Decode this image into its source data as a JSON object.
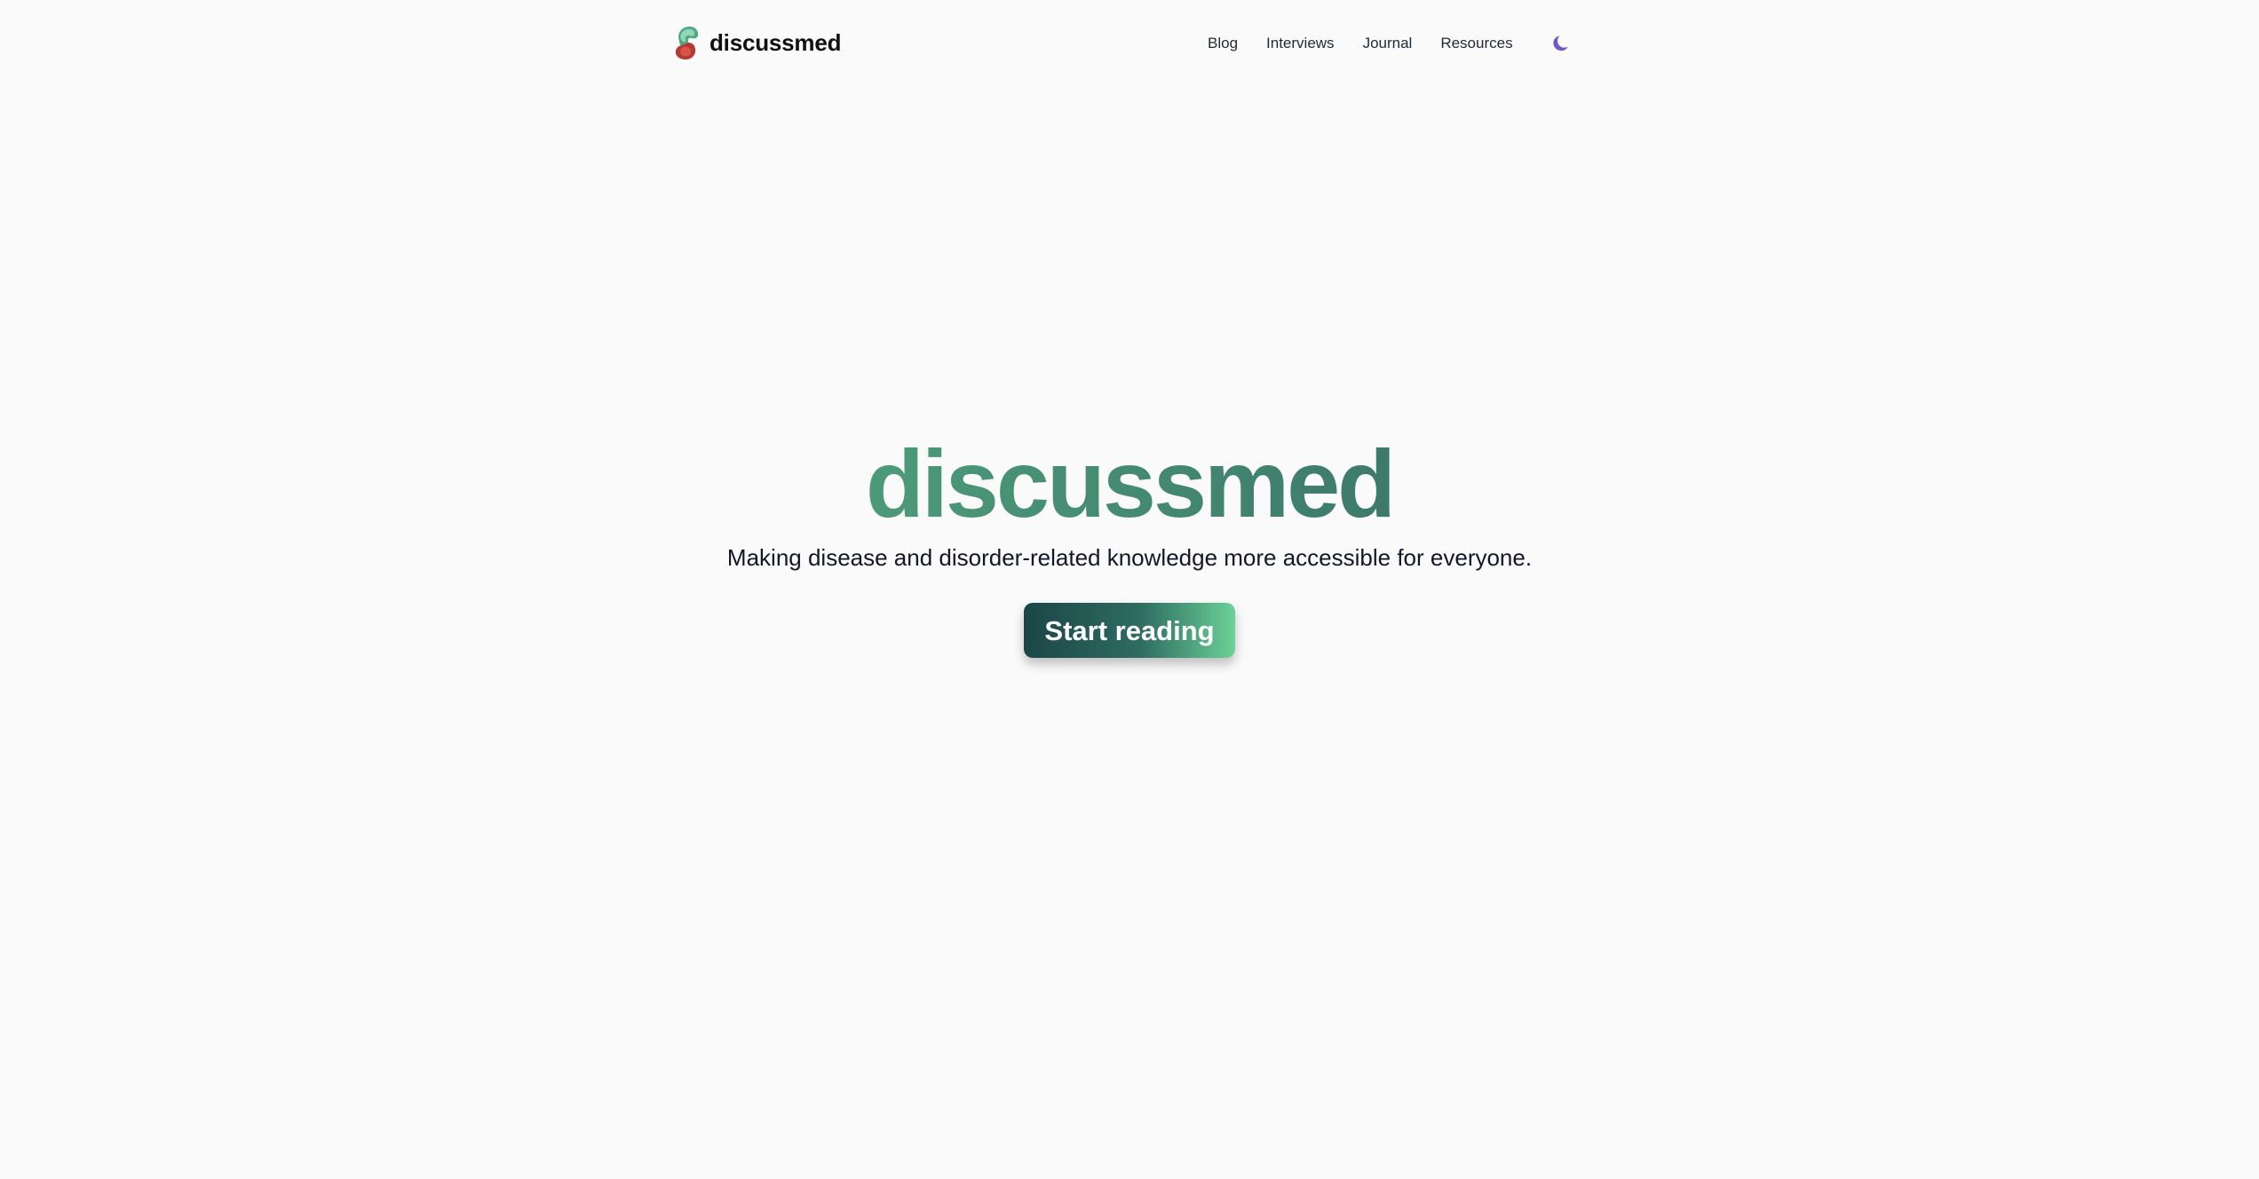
{
  "brand": {
    "name": "discussmed",
    "logo_icon": "discussmed-logo-icon"
  },
  "nav": {
    "items": [
      {
        "label": "Blog"
      },
      {
        "label": "Interviews"
      },
      {
        "label": "Journal"
      },
      {
        "label": "Resources"
      }
    ],
    "theme_toggle_icon": "moon-icon"
  },
  "hero": {
    "title": "discussmed",
    "subtitle": "Making disease and disorder-related knowledge more accessible for everyone.",
    "cta_label": "Start reading"
  },
  "colors": {
    "background": "#fafafa",
    "accent_green": "#6fcb96",
    "accent_dark": "#265250",
    "moon": "#6f58c9"
  }
}
